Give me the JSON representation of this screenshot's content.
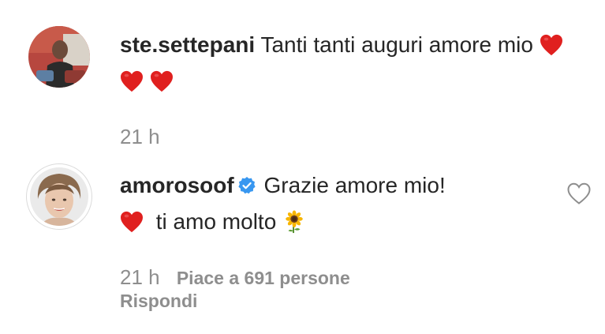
{
  "comments": [
    {
      "username": "ste.settepani",
      "verified": false,
      "text": "Tanti tanti auguri amore mio",
      "trailing_emojis": [
        "red-heart",
        "red-heart",
        "red-heart"
      ],
      "time": "21 h"
    },
    {
      "username": "amorosoof",
      "verified": true,
      "text_line1": "Grazie amore mio!",
      "text_line2": "ti amo molto",
      "leading_emoji": "red-heart",
      "trailing_emoji": "sunflower",
      "time": "21 h",
      "likes_label": "Piace a 691 persone",
      "reply_label": "Rispondi"
    }
  ],
  "colors": {
    "text": "#262626",
    "secondary": "#8e8e8e",
    "verified_badge": "#3897f0",
    "heart": "#e0201f"
  }
}
